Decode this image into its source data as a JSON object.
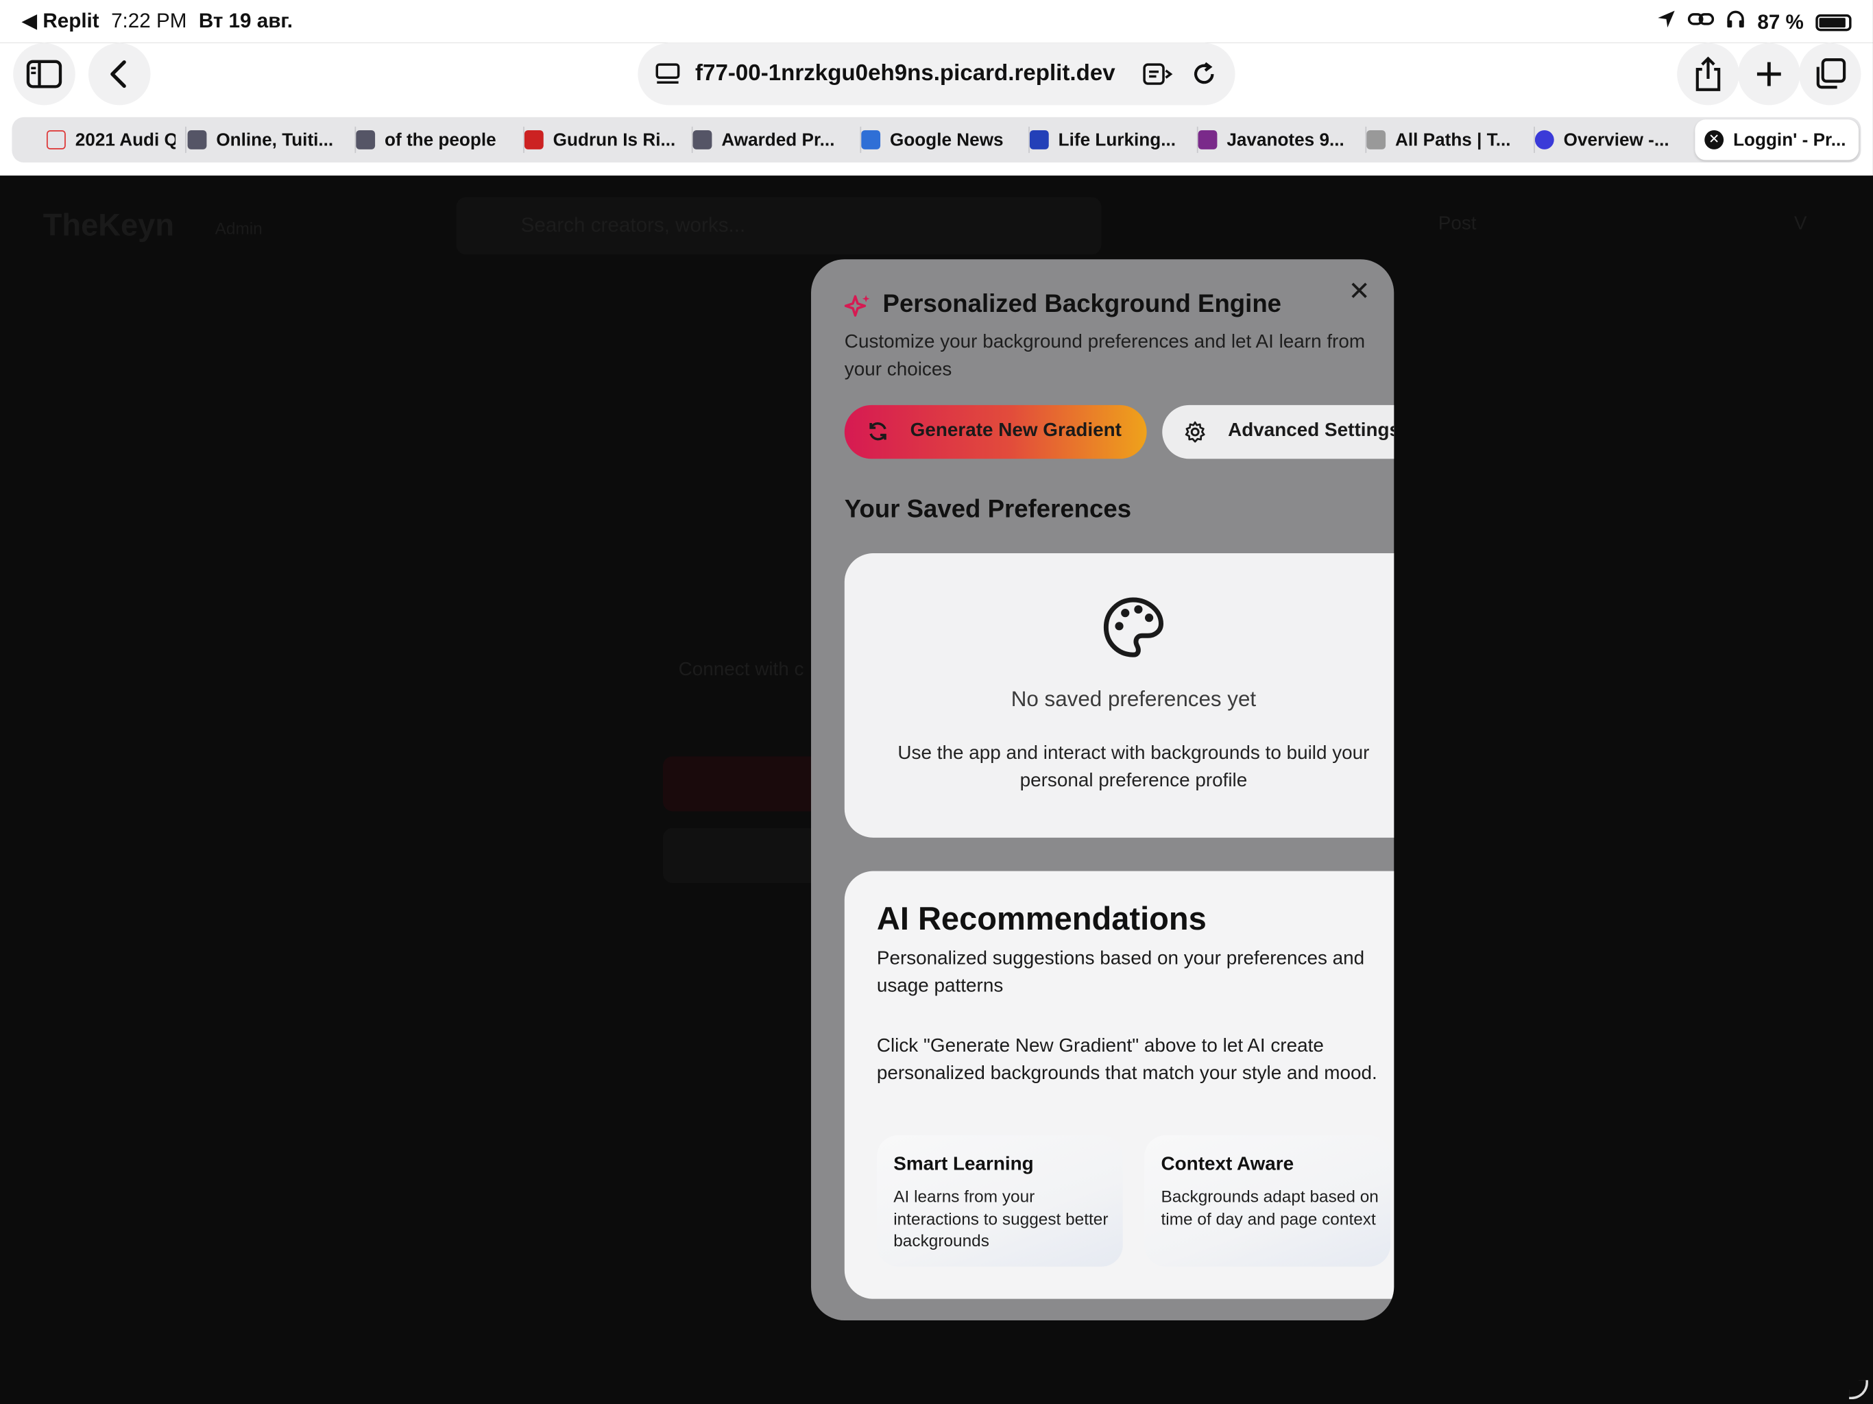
{
  "status_bar": {
    "back_app": "◀ Replit",
    "time": "7:22 PM",
    "date": "Вт 19 авг.",
    "battery": "87 %"
  },
  "browser": {
    "url": "f77-00-1nrzkgu0eh9ns.picard.replit.dev",
    "tabs": [
      {
        "label": "2021 Audi Q",
        "color": "#d33"
      },
      {
        "label": "Online, Tuiti...",
        "color": "#556"
      },
      {
        "label": "of the people",
        "color": "#556"
      },
      {
        "label": "Gudrun Is Ri...",
        "color": "#c22"
      },
      {
        "label": "Awarded Pr...",
        "color": "#556"
      },
      {
        "label": "Google News",
        "color": "#2f6fd6"
      },
      {
        "label": "Life Lurking...",
        "color": "#2340b8"
      },
      {
        "label": "Javanotes 9...",
        "color": "#7a2a8a"
      },
      {
        "label": "All Paths | T...",
        "color": "#999"
      },
      {
        "label": "Overview -...",
        "color": "#3a3ad8"
      },
      {
        "label": "Loggin' - Pr...",
        "color": "#111"
      }
    ]
  },
  "app": {
    "brand": "TheKeyn",
    "role": "Admin",
    "search_placeholder": "Search creators, works...",
    "post": "Post",
    "avatar": "V",
    "connect": "Connect with c"
  },
  "modal": {
    "title": "Personalized Background Engine",
    "description": "Customize your background preferences and let AI learn from your choices",
    "generate_label": "Generate New Gradient",
    "advanced_label": "Advanced Settings",
    "saved_title": "Your Saved Preferences",
    "empty_title": "No saved preferences yet",
    "empty_hint": "Use the app and interact with backgrounds to build your personal preference profile",
    "ai_title": "AI Recommendations",
    "ai_subtitle": "Personalized suggestions based on your preferences and usage patterns",
    "ai_body": "Click \"Generate New Gradient\" above to let AI create personalized backgrounds that match your style and mood.",
    "features": [
      {
        "title": "Smart Learning",
        "desc": "AI learns from your interactions to suggest better backgrounds"
      },
      {
        "title": "Context Aware",
        "desc": "Backgrounds adapt based on time of day and page context"
      }
    ],
    "accent": "#d61a52"
  }
}
